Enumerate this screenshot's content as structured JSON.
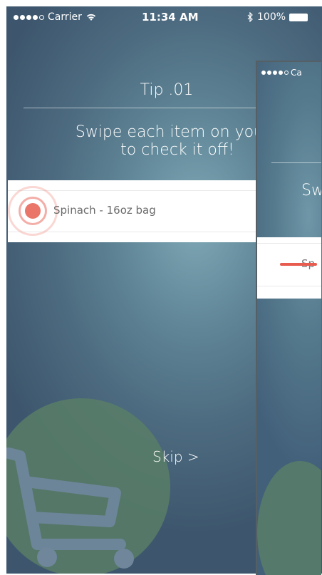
{
  "status_bar": {
    "carrier": "Carrier",
    "time": "11:34 AM",
    "battery": "100%"
  },
  "tip": {
    "title": "Tip .01",
    "instruction": "Swipe each item on your l\nto check it off!"
  },
  "sample_item": {
    "label": "Spinach - 16oz bag"
  },
  "skip_label": "Skip >",
  "preview": {
    "carrier_partial": "Ca",
    "text_partial": "Sw",
    "label_partial": "Sp"
  },
  "colors": {
    "accent_coral": "#ea7569",
    "cart_green": "#5a8066"
  },
  "icons": [
    "wifi-icon",
    "bluetooth-icon",
    "battery-icon",
    "cart-icon"
  ]
}
